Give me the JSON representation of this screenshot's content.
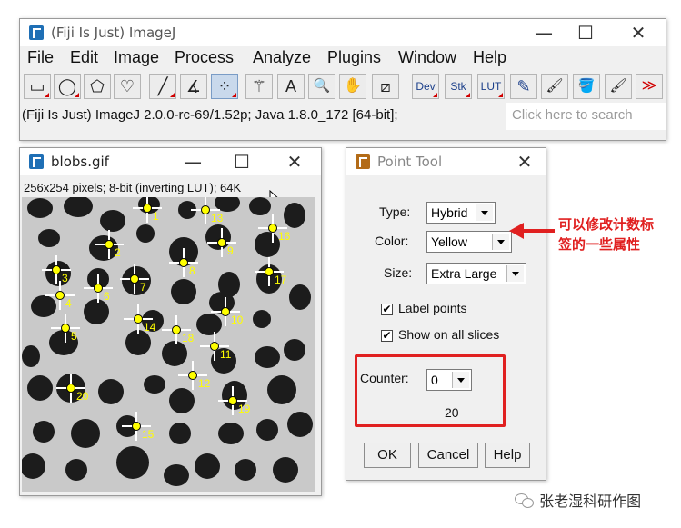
{
  "main_window": {
    "title": "(Fiji Is Just) ImageJ",
    "controls": {
      "minimize": "—",
      "maximize": "☐",
      "close": "✕"
    },
    "menu": [
      "File",
      "Edit",
      "Image",
      "Process",
      "Analyze",
      "Plugins",
      "Window",
      "Help"
    ],
    "tools": [
      {
        "name": "rectangle-tool",
        "glyph": "▭"
      },
      {
        "name": "oval-tool",
        "glyph": "◯"
      },
      {
        "name": "polygon-tool",
        "glyph": "⬠"
      },
      {
        "name": "freehand-tool",
        "glyph": "♡"
      },
      {
        "name": "line-tool",
        "glyph": "╱"
      },
      {
        "name": "angle-tool",
        "glyph": "∡"
      },
      {
        "name": "multipoint-tool",
        "glyph": "⁘"
      },
      {
        "name": "wand-tool",
        "glyph": "⚚"
      },
      {
        "name": "text-tool",
        "glyph": "A"
      },
      {
        "name": "magnifier-tool",
        "glyph": "🔍"
      },
      {
        "name": "hand-tool",
        "glyph": "✋"
      },
      {
        "name": "color-picker-tool",
        "glyph": "⧄"
      },
      {
        "name": "dev-tool",
        "glyph": "Dev"
      },
      {
        "name": "stk-tool",
        "glyph": "Stk"
      },
      {
        "name": "lut-tool",
        "glyph": "LUT"
      },
      {
        "name": "pencil-tool",
        "glyph": "✎"
      },
      {
        "name": "brush-tool",
        "glyph": "🖌"
      },
      {
        "name": "flood-fill-tool",
        "glyph": "🪣"
      },
      {
        "name": "paintbrush-tool",
        "glyph": "🖌"
      },
      {
        "name": "more-tools",
        "glyph": "≫"
      }
    ],
    "status_text": "(Fiji Is Just) ImageJ 2.0.0-rc-69/1.52p; Java 1.8.0_172 [64-bit];",
    "search_placeholder": "Click here to search"
  },
  "image_window": {
    "title": "blobs.gif",
    "controls": {
      "minimize": "—",
      "maximize": "☐",
      "close": "✕"
    },
    "info": "256x254 pixels; 8-bit (inverting LUT); 64K",
    "point_labels": [
      "1",
      "2",
      "3",
      "4",
      "5",
      "6",
      "7",
      "8",
      "9",
      "10",
      "11",
      "12",
      "13",
      "14",
      "15",
      "16",
      "17",
      "18",
      "19",
      "20"
    ]
  },
  "point_tool_dialog": {
    "title": "Point Tool",
    "close": "✕",
    "type_label": "Type:",
    "type_value": "Hybrid",
    "color_label": "Color:",
    "color_value": "Yellow",
    "size_label": "Size:",
    "size_value": "Extra Large",
    "label_points": "Label points",
    "show_all_slices": "Show on all slices",
    "counter_label": "Counter:",
    "counter_value": "0",
    "count": "20",
    "ok": "OK",
    "cancel": "Cancel",
    "help": "Help"
  },
  "annotation": {
    "line1": "可以修改计数标",
    "line2": "签的一些属性"
  },
  "watermark": "张老湿科研作图",
  "colors": {
    "highlight": "#e02020",
    "point": "#ffff00"
  }
}
